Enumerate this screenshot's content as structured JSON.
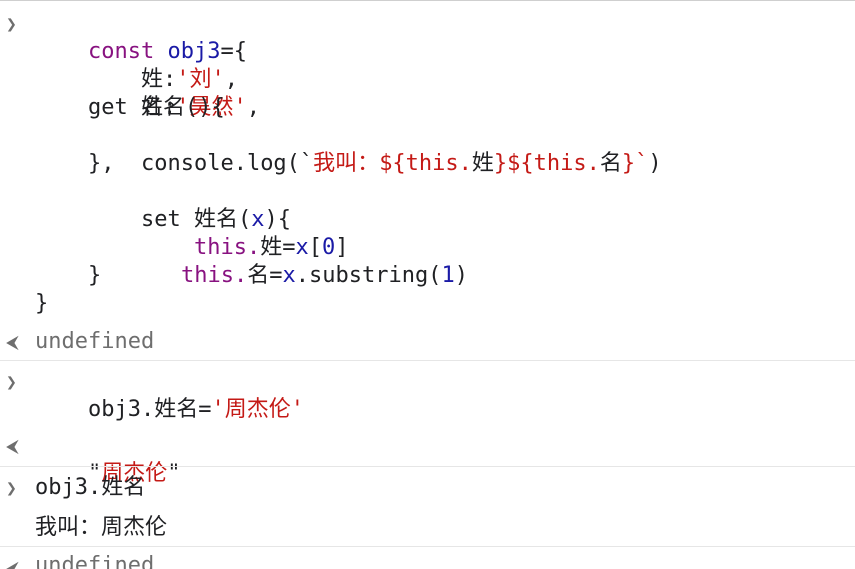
{
  "console": {
    "prompt_input": "❯",
    "prompt_output": "⮜",
    "entry1": {
      "l1": {
        "kw": "const",
        "name": "obj3",
        "eq": "={"
      },
      "l2": {
        "key": "姓",
        "colon": ":",
        "q1": "'",
        "val": "刘",
        "q2": "'",
        "comma": ","
      },
      "l3": {
        "key": "名",
        "colon": ":",
        "q1": "'",
        "val": "昊然",
        "q2": "'",
        "comma": ","
      },
      "l4": {
        "text": "get 姓名(){"
      },
      "l5": {
        "pre": "console.log(`",
        "s1": "我叫：",
        "t1": "${this.",
        "k1": "姓",
        "t2": "}${this.",
        "k2": "名",
        "t3": "}`",
        "post": ")"
      },
      "l6": {
        "text": "},"
      },
      "l7": {
        "pre": "set 姓名(",
        "arg": "x",
        "post": "){"
      },
      "l8": {
        "a": "this.",
        "b": "姓",
        "eq": "=",
        "x": "x",
        "br1": "[",
        "idx": "0",
        "br2": "]"
      },
      "l9": {
        "a": "this.",
        "b": "名",
        "eq": "=",
        "x": "x",
        "rest": ".substring(",
        "n": "1",
        "end": ")"
      },
      "l10": {
        "text": "}"
      },
      "l11": {
        "text": "}"
      }
    },
    "result1": "undefined",
    "entry2": {
      "pre": "obj3.姓名=",
      "q1": "'",
      "val": "周杰伦",
      "q2": "'"
    },
    "result2": {
      "q1": "\"",
      "val": "周杰伦",
      "q2": "\""
    },
    "entry3": "obj3.姓名",
    "log3": "我叫：周杰伦",
    "result3": "undefined"
  }
}
